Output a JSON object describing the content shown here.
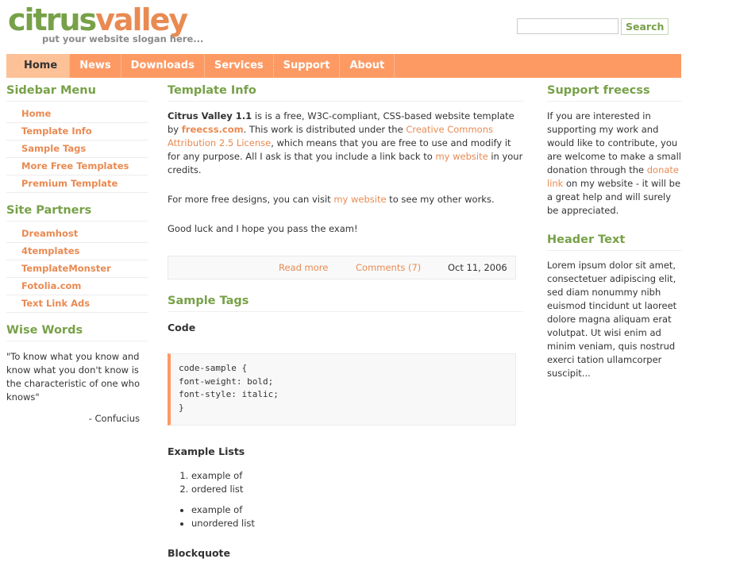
{
  "header": {
    "logo_part1": "citrus",
    "logo_part2": "valley",
    "slogan": "put your website slogan here...",
    "search_value": "",
    "search_button": "Search"
  },
  "nav": [
    "Home",
    "News",
    "Downloads",
    "Services",
    "Support",
    "About"
  ],
  "sidebar": {
    "menu_title": "Sidebar Menu",
    "menu_items": [
      "Home",
      "Template Info",
      "Sample Tags",
      "More Free Templates",
      "Premium Template"
    ],
    "partners_title": "Site Partners",
    "partner_items": [
      "Dreamhost",
      "4templates",
      "TemplateMonster",
      "Fotolia.com",
      "Text Link Ads"
    ],
    "wise_title": "Wise Words",
    "quote": "\"To know what you know and know what you don't know is the characteristic of one who knows\"",
    "quote_author": "- Confucius"
  },
  "main": {
    "title": "Template Info",
    "p1_bold": "Citrus Valley 1.1",
    "p1_a": " is is a free, W3C-compliant, CSS-based website template by ",
    "p1_link1": "freecss.com",
    "p1_b": ". This work is distributed under the ",
    "p1_link2": "Creative Commons Attribution 2.5 License",
    "p1_c": ", which means that you are free to use and modify it for any purpose. All I ask is that you include a link back to ",
    "p1_link3": "my website",
    "p1_d": " in your credits.",
    "p2_a": "For more free designs, you can visit ",
    "p2_link": "my website",
    "p2_b": " to see my other works.",
    "p3": "Good luck and I hope you pass the exam!",
    "read_more": "Read more",
    "comments": "Comments (7)",
    "date": "Oct 11, 2006",
    "sample_title": "Sample Tags",
    "code_title": "Code",
    "code_lines": [
      "code-sample {",
      "font-weight: bold;",
      "font-style: italic;",
      "}"
    ],
    "lists_title": "Example Lists",
    "ordered": [
      "example of",
      "ordered list"
    ],
    "unordered": [
      "example of",
      "unordered list"
    ],
    "blockquote_title": "Blockquote"
  },
  "right": {
    "support_title": "Support freecss",
    "support_a": "If you are interested in supporting my work and would like to contribute, you are welcome to make a small donation through the ",
    "support_link": "donate link",
    "support_b": " on my website - it will be a great help and will surely be appreciated.",
    "header_title": "Header Text",
    "header_text": "Lorem ipsum dolor sit amet, consectetuer adipiscing elit, sed diam nonummy nibh euismod tincidunt ut laoreet dolore magna aliquam erat volutpat. Ut wisi enim ad minim veniam, quis nostrud exerci tation ullamcorper suscipit..."
  },
  "colors": {
    "accent_green": "#77a148",
    "accent_orange": "#e98a52",
    "nav_bg": "#fd9a64"
  }
}
